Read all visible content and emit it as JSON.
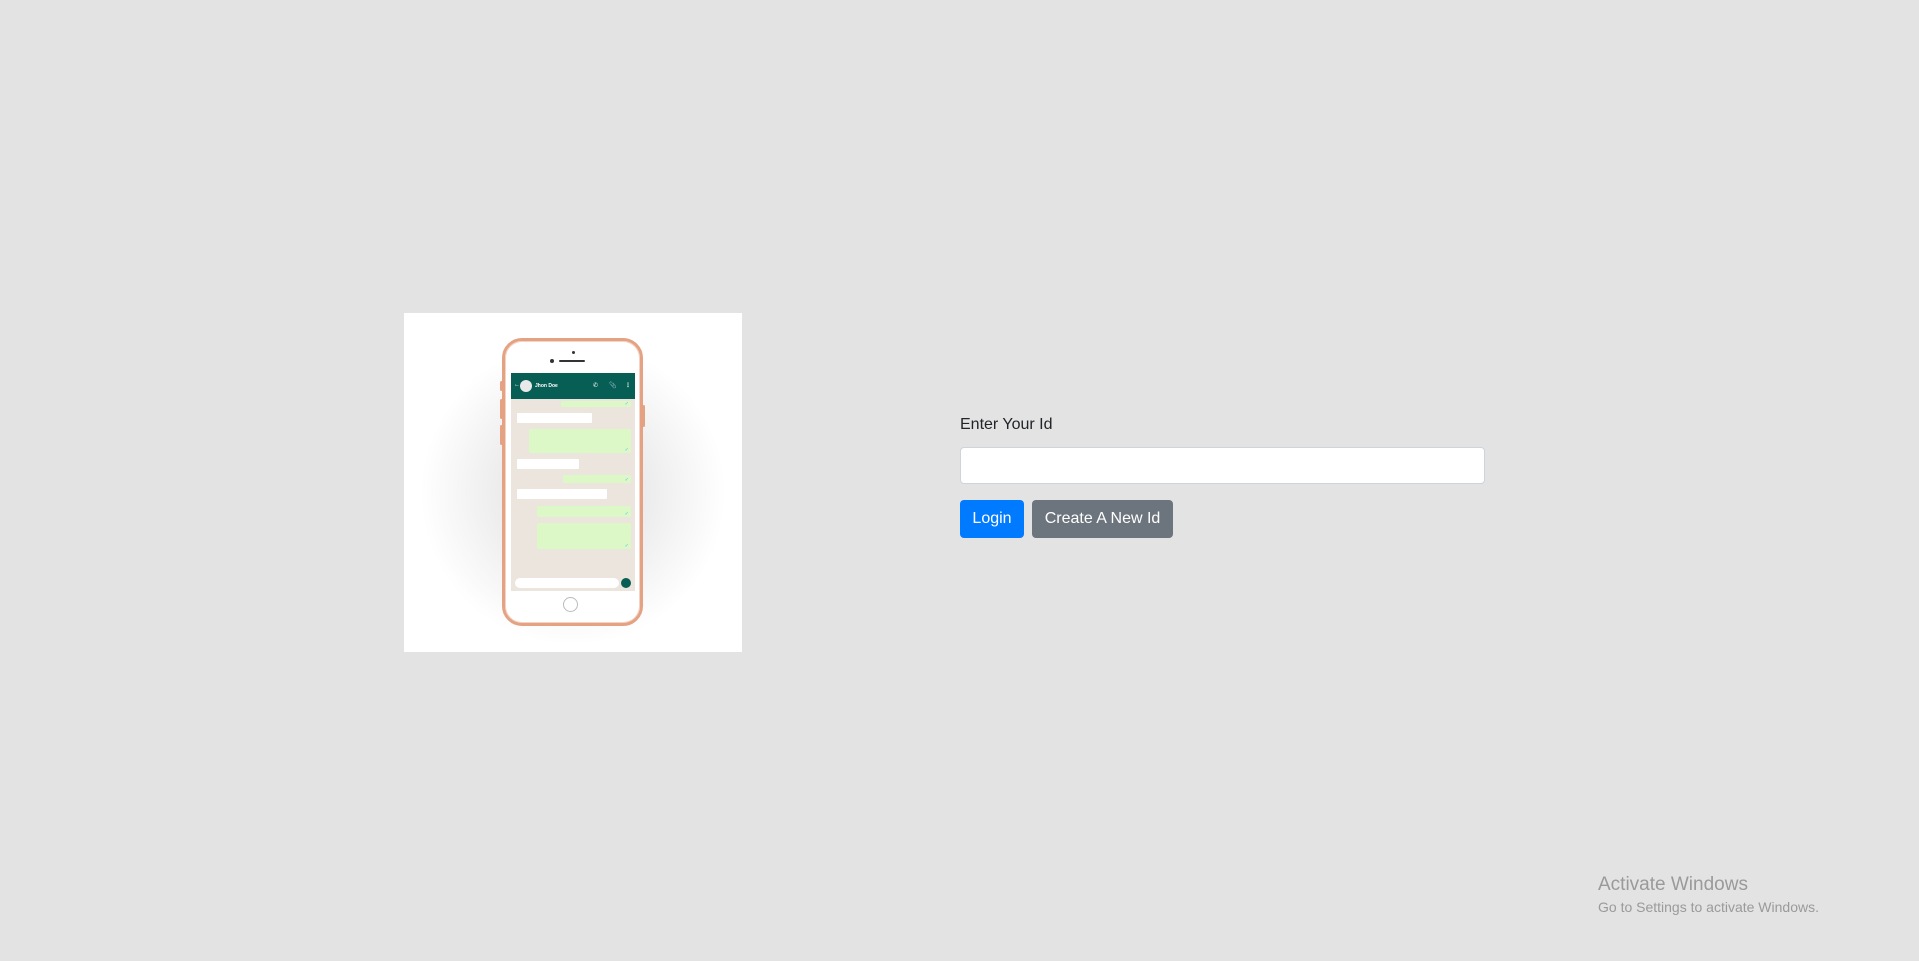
{
  "illustration": {
    "contact_name": "Jhon Doe"
  },
  "form": {
    "label": "Enter Your Id",
    "id_value": "",
    "id_placeholder": "",
    "login_label": "Login",
    "create_label": "Create A New Id"
  },
  "colors": {
    "background": "#e3e3e3",
    "primary": "#007bff",
    "secondary": "#6c757d",
    "whatsapp_header": "#075e54"
  },
  "watermark": {
    "title": "Activate Windows",
    "subtitle": "Go to Settings to activate Windows."
  }
}
